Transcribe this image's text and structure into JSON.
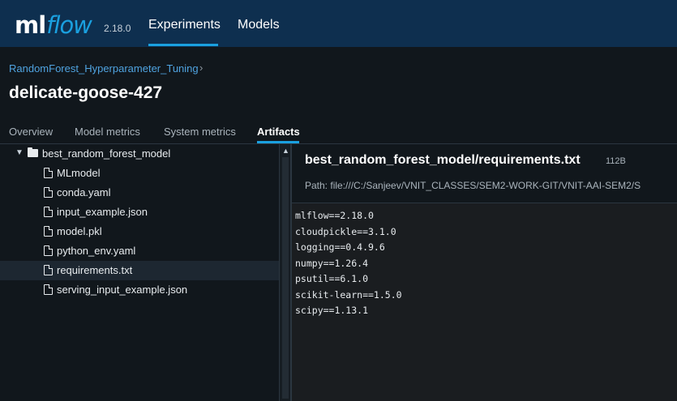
{
  "app": {
    "logo_ml": "ml",
    "logo_flow": "flow",
    "version": "2.18.0"
  },
  "nav": {
    "experiments": "Experiments",
    "models": "Models"
  },
  "breadcrumb": {
    "experiment": "RandomForest_Hyperparameter_Tuning",
    "separator": "›"
  },
  "run": {
    "title": "delicate-goose-427"
  },
  "tabs": [
    {
      "label": "Overview"
    },
    {
      "label": "Model metrics"
    },
    {
      "label": "System metrics"
    },
    {
      "label": "Artifacts",
      "active": true
    }
  ],
  "tree": {
    "root": "best_random_forest_model",
    "items": [
      {
        "label": "MLmodel"
      },
      {
        "label": "conda.yaml"
      },
      {
        "label": "input_example.json"
      },
      {
        "label": "model.pkl"
      },
      {
        "label": "python_env.yaml"
      },
      {
        "label": "requirements.txt",
        "selected": true
      },
      {
        "label": "serving_input_example.json"
      }
    ]
  },
  "artifact": {
    "title": "best_random_forest_model/requirements.txt",
    "size": "112B",
    "path": "Path: file:///C:/Sanjeev/VNIT_CLASSES/SEM2-WORK-GIT/VNIT-AAI-SEM2/S",
    "lines": [
      "mlflow==2.18.0",
      "cloudpickle==3.1.0",
      "logging==0.4.9.6",
      "numpy==1.26.4",
      "psutil==6.1.0",
      "scikit-learn==1.5.0",
      "scipy==1.13.1"
    ]
  },
  "colors": {
    "nav_bg": "#0e2f4f",
    "accent": "#1aa0df",
    "page_bg": "#11171c",
    "link": "#4fa3e0"
  }
}
